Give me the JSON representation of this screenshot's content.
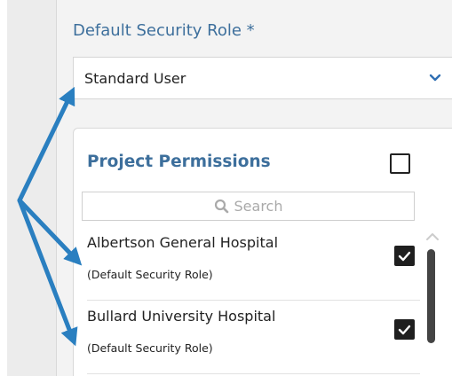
{
  "security_role": {
    "label": "Default Security Role *",
    "selected_value": "Standard User"
  },
  "project_permissions": {
    "title": "Project Permissions",
    "select_all_checked": false,
    "search": {
      "placeholder": "Search"
    },
    "items": [
      {
        "name": "Albertson General Hospital",
        "role": "(Default Security Role)",
        "checked": true
      },
      {
        "name": "Bullard University Hospital",
        "role": "(Default Security Role)",
        "checked": true
      }
    ]
  },
  "icons": {
    "dropdown": "chevron-down-icon",
    "search": "search-icon",
    "scroll_up": "chevron-up-icon",
    "checked": "checkmark-icon"
  },
  "colors": {
    "accent": "#3d6f9c",
    "annotation_arrow": "#2a7fc0",
    "checkbox_fill": "#1f1f1f",
    "gutter": "#ececec",
    "panel": "#f3f3f3"
  }
}
